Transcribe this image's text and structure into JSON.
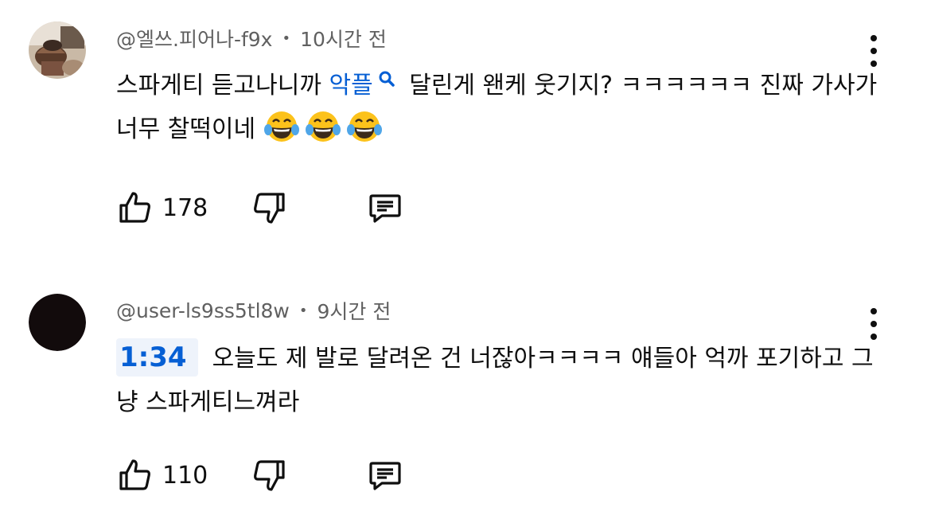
{
  "comments": [
    {
      "author": "@엘쓰.피어나-f9x",
      "separator": "•",
      "time": "10시간 전",
      "text_before": "스파게티 듣고나니까 ",
      "link_text": "악플",
      "text_after": " 달린게 왠케 웃기지? ㅋㅋㅋㅋㅋㅋ 진짜 가사가 너무 찰떡이네 ",
      "emoji_count": 3,
      "emoji_name": "face-with-tears-of-joy",
      "like_count": "178",
      "avatar": "coffee-drink-photo"
    },
    {
      "author": "@user-ls9ss5tl8w",
      "separator": "•",
      "time": "9시간 전",
      "timestamp_link": "1:34",
      "text": "오늘도 제 발로 달려온 건 너잖아ㅋㅋㅋㅋ 얘들아 억까 포기하고 그냥 스파게티느껴라",
      "like_count": "110",
      "avatar": "dark-circle"
    }
  ],
  "icons": {
    "like": "thumbs-up-icon",
    "dislike": "thumbs-down-icon",
    "reply": "comment-reply-icon",
    "menu": "more-vertical-icon",
    "search": "search-icon"
  },
  "colors": {
    "link": "#065fd4",
    "meta": "#606060",
    "text": "#0f0f0f",
    "timestamp_bg": "#eef3fb"
  }
}
